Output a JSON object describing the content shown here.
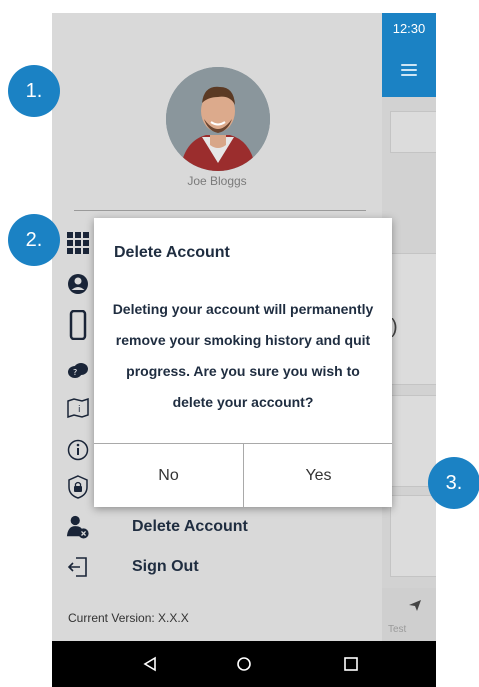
{
  "status": {
    "time": "12:30"
  },
  "drawer": {
    "user_name": "Joe Bloggs",
    "menu": [
      {
        "icon": "grid-icon",
        "label": ""
      },
      {
        "icon": "account-circle-icon",
        "label": ""
      },
      {
        "icon": "phone-icon",
        "label": ""
      },
      {
        "icon": "chat-help-icon",
        "label": ""
      },
      {
        "icon": "info-map-icon",
        "label": ""
      },
      {
        "icon": "info-icon",
        "label": ""
      },
      {
        "icon": "lock-shield-icon",
        "label": ""
      },
      {
        "icon": "delete-account-icon",
        "label": "Delete Account"
      },
      {
        "icon": "sign-out-icon",
        "label": "Sign Out"
      }
    ],
    "version": "Current Version: X.X.X"
  },
  "background_app": {
    "partial_label": "Test"
  },
  "dialog": {
    "title": "Delete Account",
    "message": "Deleting your account will permanently remove your smoking history and quit progress. Are you sure you wish to delete your account?",
    "no_label": "No",
    "yes_label": "Yes"
  },
  "callouts": [
    "1.",
    "2.",
    "3."
  ],
  "colors": {
    "accent": "#1b82c4",
    "drawer_bg": "#d9d9d9",
    "text_dark": "#1f2d40"
  }
}
